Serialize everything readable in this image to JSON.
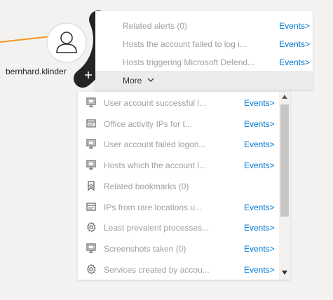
{
  "node": {
    "label": "bernhard.klinder",
    "icon": "user-icon"
  },
  "menu": {
    "items": [
      {
        "label": "Related alerts (0)",
        "events": "Events>",
        "icon": "shield-icon"
      },
      {
        "label": "Hosts the account failed to log i...",
        "events": "Events>",
        "icon": "monitor-icon"
      },
      {
        "label": "Hosts triggering Microsoft Defend...",
        "events": "Events>",
        "icon": "monitor-icon"
      }
    ],
    "more_label": "More",
    "add_icon": "plus-icon"
  },
  "list": {
    "items": [
      {
        "label": "User account successful l...",
        "events": "Events>",
        "icon": "monitor-icon"
      },
      {
        "label": "Office activity IPs for t...",
        "events": "Events>",
        "icon": "window-icon"
      },
      {
        "label": "User account failed logon...",
        "events": "Events>",
        "icon": "monitor-icon"
      },
      {
        "label": "Hosts which the account l...",
        "events": "Events>",
        "icon": "monitor-icon"
      },
      {
        "label": "Related bookmarks (0)",
        "events": "",
        "icon": "bookmark-icon"
      },
      {
        "label": "IPs from rare locations u...",
        "events": "Events>",
        "icon": "window-icon"
      },
      {
        "label": "Least prevalent processes...",
        "events": "Events>",
        "icon": "gear-icon"
      },
      {
        "label": "Screenshots taken (0)",
        "events": "Events>",
        "icon": "monitor-icon"
      },
      {
        "label": "Services created by accou...",
        "events": "Events>",
        "icon": "gear-icon"
      }
    ]
  },
  "colors": {
    "background": "#f3f2f1",
    "link": "#0078d4",
    "disabled_text": "#a19f9d",
    "arc": "#252423",
    "edge": "#f7941d"
  }
}
